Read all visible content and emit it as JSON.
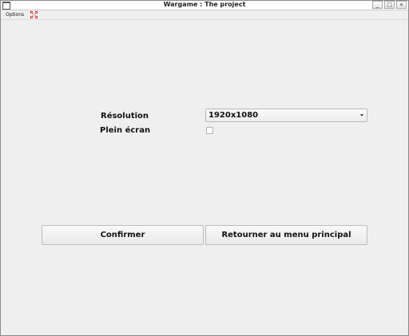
{
  "window": {
    "title": "Wargame : The project",
    "minimize_glyph": "_",
    "maximize_glyph": "□",
    "close_glyph": "×"
  },
  "menubar": {
    "options_label": "Options",
    "fullscreen_icon": "fullscreen-toggle-icon",
    "fullscreen_icon_color": "#d03030"
  },
  "settings": {
    "resolution_label": "Résolution",
    "resolution_value": "1920x1080",
    "fullscreen_label": "Plein écran",
    "fullscreen_checked": false
  },
  "buttons": {
    "confirm_label": "Confirmer",
    "back_label": "Retourner au menu principal"
  }
}
